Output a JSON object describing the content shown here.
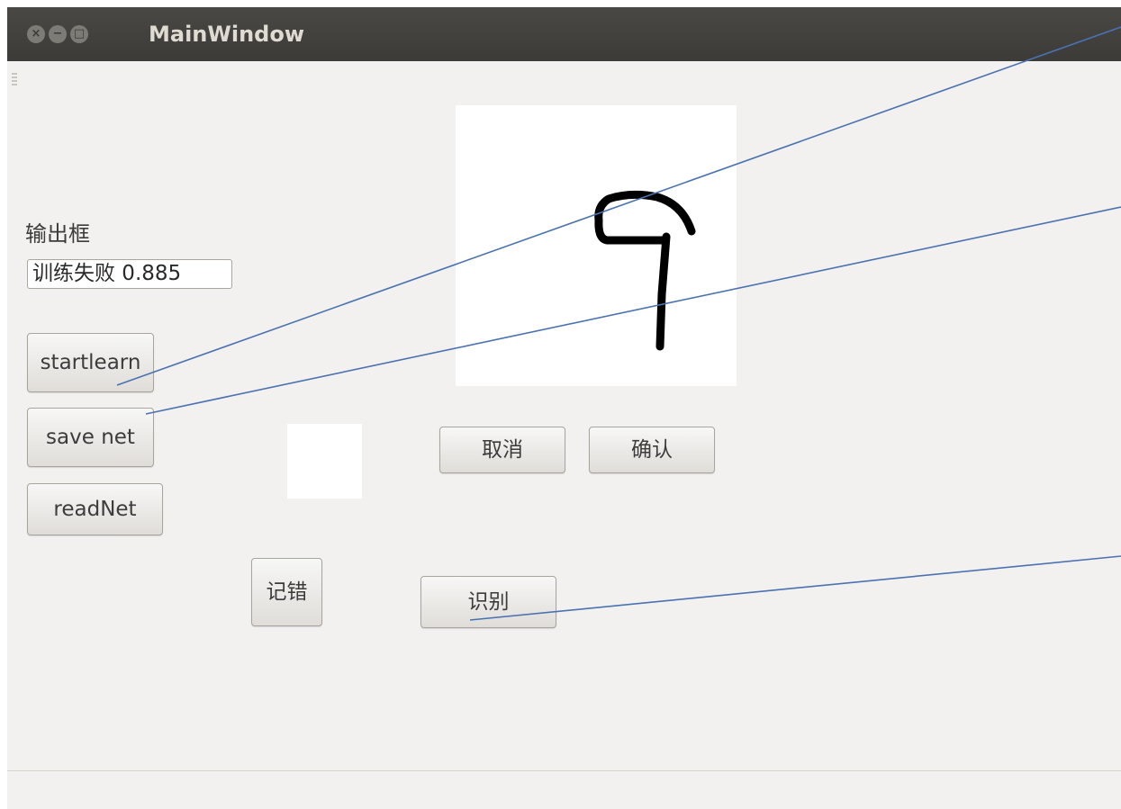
{
  "window": {
    "title": "MainWindow",
    "controls": [
      "close-icon",
      "minimize-icon",
      "maximize-icon"
    ]
  },
  "output": {
    "label": "输出框",
    "value": "训练失败 0.885"
  },
  "buttons": {
    "startlearn": "startlearn",
    "save_net": "save net",
    "read_net": "readNet",
    "record_error": "记错",
    "cancel": "取消",
    "confirm": "确认",
    "recognize": "识别"
  },
  "colors": {
    "annotation_line": "#4a72b0",
    "titlebar": "#3c3b37",
    "window_bg": "#f2f1f0"
  }
}
